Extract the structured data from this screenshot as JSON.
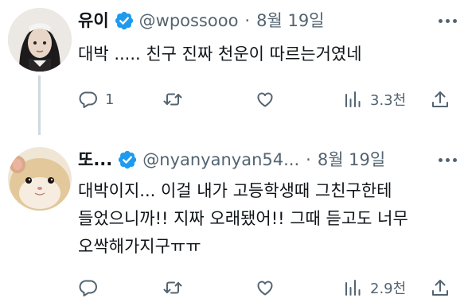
{
  "tweets": [
    {
      "name": "유이",
      "handle": "@wpossooo",
      "dot": "·",
      "date": "8월 19일",
      "text": "대박 ..... 친구 진짜 천운이 따르는거였네",
      "reply_count": "1",
      "retweet_count": "",
      "like_count": "",
      "view_count": "3.3천"
    },
    {
      "name": "또...",
      "handle": "@nyanyanyan54...",
      "dot": "·",
      "date": "8월 19일",
      "text": "대박이지... 이걸 내가 고등학생때 그친구한테 들었으니까!! 지짜 오래됐어!! 그때 듣고도 너무 오싹해가지구ㅠㅠ",
      "reply_count": "",
      "retweet_count": "",
      "like_count": "",
      "view_count": "2.9천"
    }
  ],
  "colors": {
    "text": "#0f1419",
    "secondary": "#536471",
    "verified": "#1d9bf0",
    "thread_line": "#cfd9de"
  },
  "icons": [
    "verified-badge-icon",
    "more-icon",
    "reply-icon",
    "retweet-icon",
    "like-icon",
    "views-icon",
    "share-icon"
  ]
}
